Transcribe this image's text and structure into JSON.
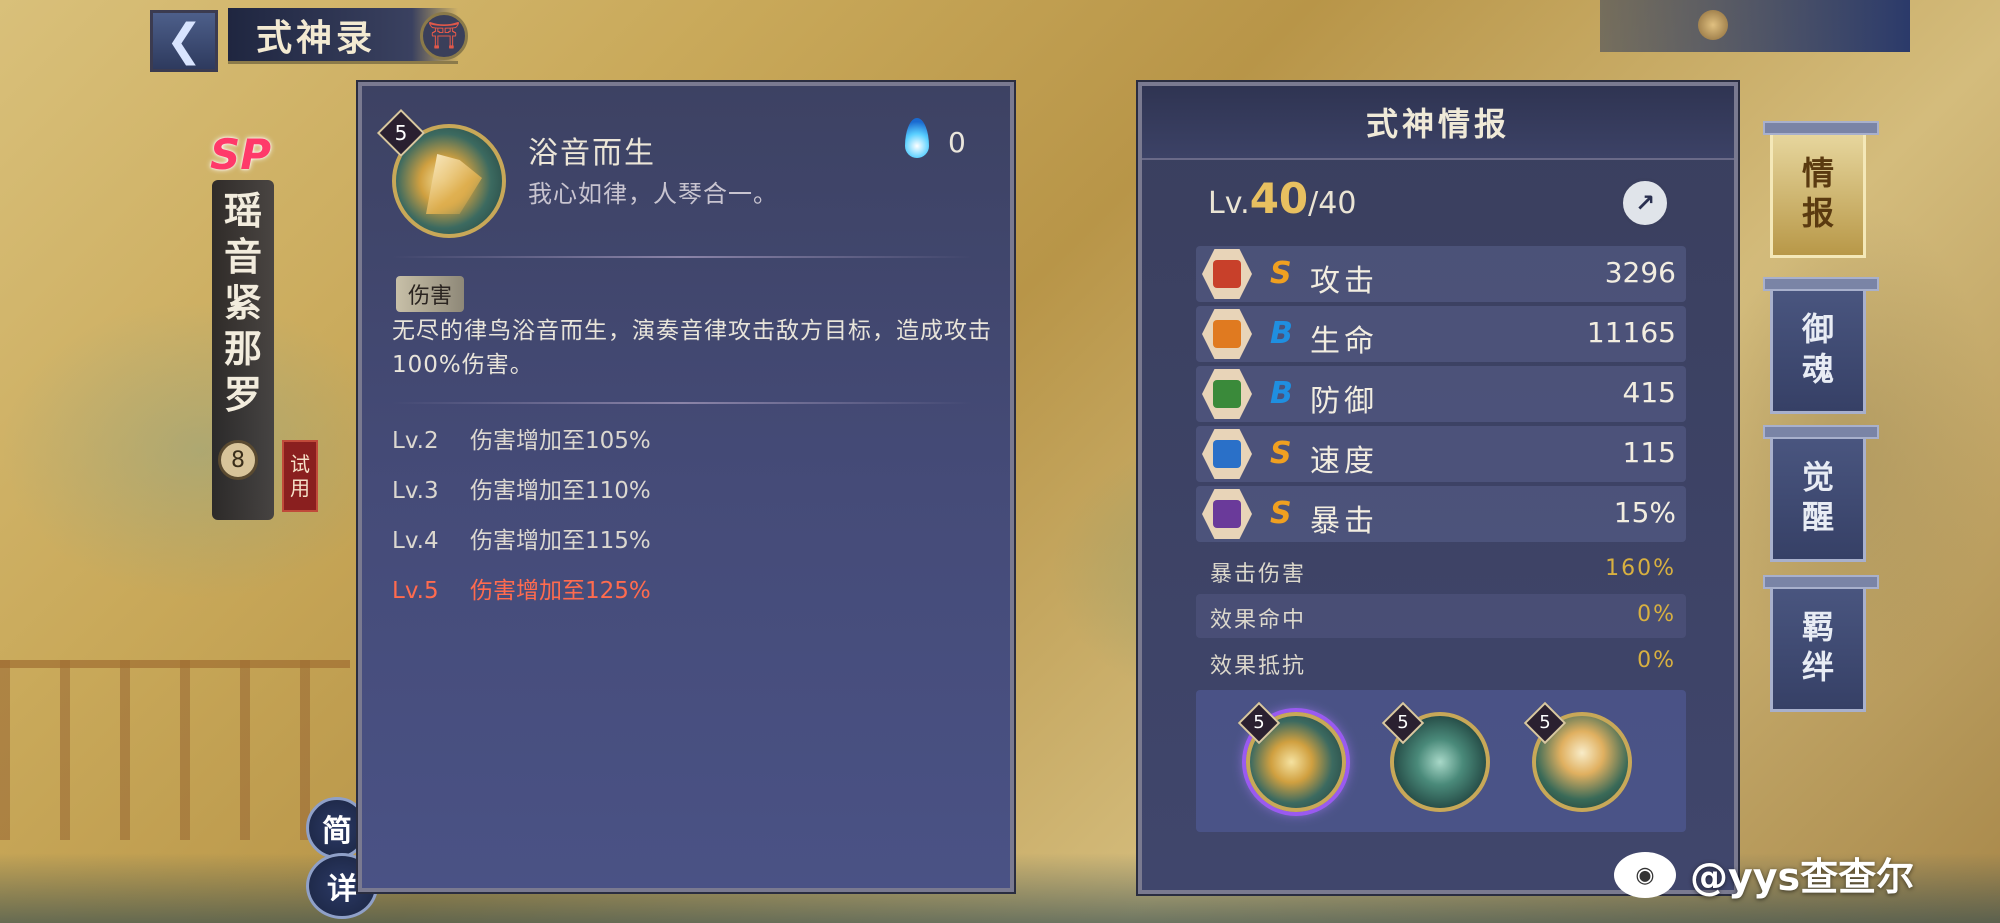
{
  "header": {
    "title": "式神录",
    "back_icon": "chevron-left-icon",
    "torii_icon": "torii-icon"
  },
  "shikigami": {
    "rarity": "SP",
    "name_chars": [
      "瑶",
      "音",
      "紧",
      "那",
      "罗"
    ],
    "trial_chars": [
      "试",
      "用"
    ],
    "lock_glyph": "8"
  },
  "view_buttons": {
    "simple": "简",
    "detail": "详"
  },
  "skill": {
    "level": "5",
    "name": "浴音而生",
    "quote": "我心如律，人琴合一。",
    "cost": "0",
    "tag": "伤害",
    "description": "无尽的律鸟浴音而生，演奏音律攻击敌方目标，造成攻击100%伤害。",
    "levels": [
      {
        "lv": "Lv.2",
        "text": "伤害增加至105%"
      },
      {
        "lv": "Lv.3",
        "text": "伤害增加至110%"
      },
      {
        "lv": "Lv.4",
        "text": "伤害增加至115%"
      },
      {
        "lv": "Lv.5",
        "text": "伤害增加至125%"
      }
    ]
  },
  "info": {
    "title": "式神情报",
    "level_prefix": "Lv.",
    "level": "40",
    "level_max": "/40",
    "stats": [
      {
        "icon": "fan-icon",
        "grade": "S",
        "name": "攻击",
        "value": "3296",
        "color": "#c8402a"
      },
      {
        "icon": "talisman-icon",
        "grade": "B",
        "name": "生命",
        "value": "11165",
        "color": "#e07a20"
      },
      {
        "icon": "armor-icon",
        "grade": "B",
        "name": "防御",
        "value": "415",
        "color": "#3a8a3a"
      },
      {
        "icon": "speed-chevron-icon",
        "grade": "S",
        "name": "速度",
        "value": "115",
        "color": "#2a70c8"
      },
      {
        "icon": "crit-scroll-icon",
        "grade": "S",
        "name": "暴击",
        "value": "15%",
        "color": "#6a3a9a"
      }
    ],
    "sub_stats": [
      {
        "name": "暴击伤害",
        "value": "160%"
      },
      {
        "name": "效果命中",
        "value": "0%"
      },
      {
        "name": "效果抵抗",
        "value": "0%"
      }
    ],
    "skill_levels": [
      "5",
      "5",
      "5"
    ]
  },
  "side_tabs": [
    {
      "chars": [
        "情",
        "报"
      ],
      "active": true
    },
    {
      "chars": [
        "御",
        "魂"
      ],
      "active": false
    },
    {
      "chars": [
        "觉",
        "醒"
      ],
      "active": false
    },
    {
      "chars": [
        "羁",
        "绊"
      ],
      "active": false
    }
  ],
  "watermark": "@yys查查尔",
  "colors": {
    "accent_gold": "#e8c060",
    "max_level_red": "#ff6b4e",
    "grade_s": "#f0a020",
    "grade_b": "#1f8fe0"
  }
}
